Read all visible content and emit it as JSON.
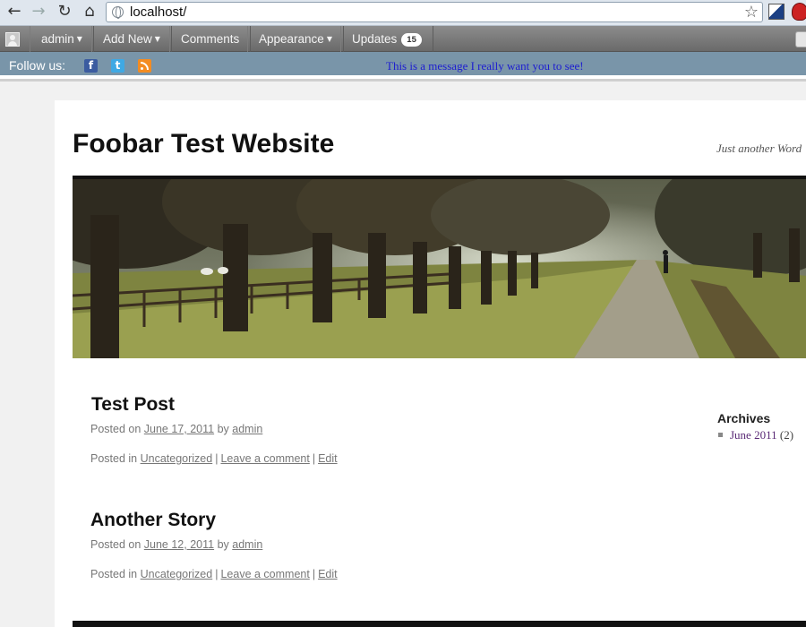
{
  "browser": {
    "url": "localhost/"
  },
  "admin_bar": {
    "items": [
      {
        "label": "admin"
      },
      {
        "label": "Add New"
      },
      {
        "label": "Comments"
      },
      {
        "label": "Appearance"
      },
      {
        "label": "Updates",
        "badge": "15"
      }
    ]
  },
  "follow_bar": {
    "label": "Follow us:",
    "message": "This is a message I really want you to see!"
  },
  "site": {
    "title": "Foobar Test Website",
    "tagline": "Just another Word"
  },
  "posts": [
    {
      "title": "Test Post",
      "posted_on": "Posted on",
      "date": "June 17, 2011",
      "by": "by",
      "author": "admin",
      "posted_in": "Posted in",
      "category": "Uncategorized",
      "comment_link": "Leave a comment",
      "edit_link": "Edit"
    },
    {
      "title": "Another Story",
      "posted_on": "Posted on",
      "date": "June 12, 2011",
      "by": "by",
      "author": "admin",
      "posted_in": "Posted in",
      "category": "Uncategorized",
      "comment_link": "Leave a comment",
      "edit_link": "Edit"
    }
  ],
  "sidebar": {
    "archives_title": "Archives",
    "archives": [
      {
        "label": "June 2011",
        "count": "(2)"
      }
    ]
  },
  "colors": {
    "follow_bar": "#7995a9",
    "message_text": "#1d1dd0",
    "archive_link": "#5a2a76"
  }
}
